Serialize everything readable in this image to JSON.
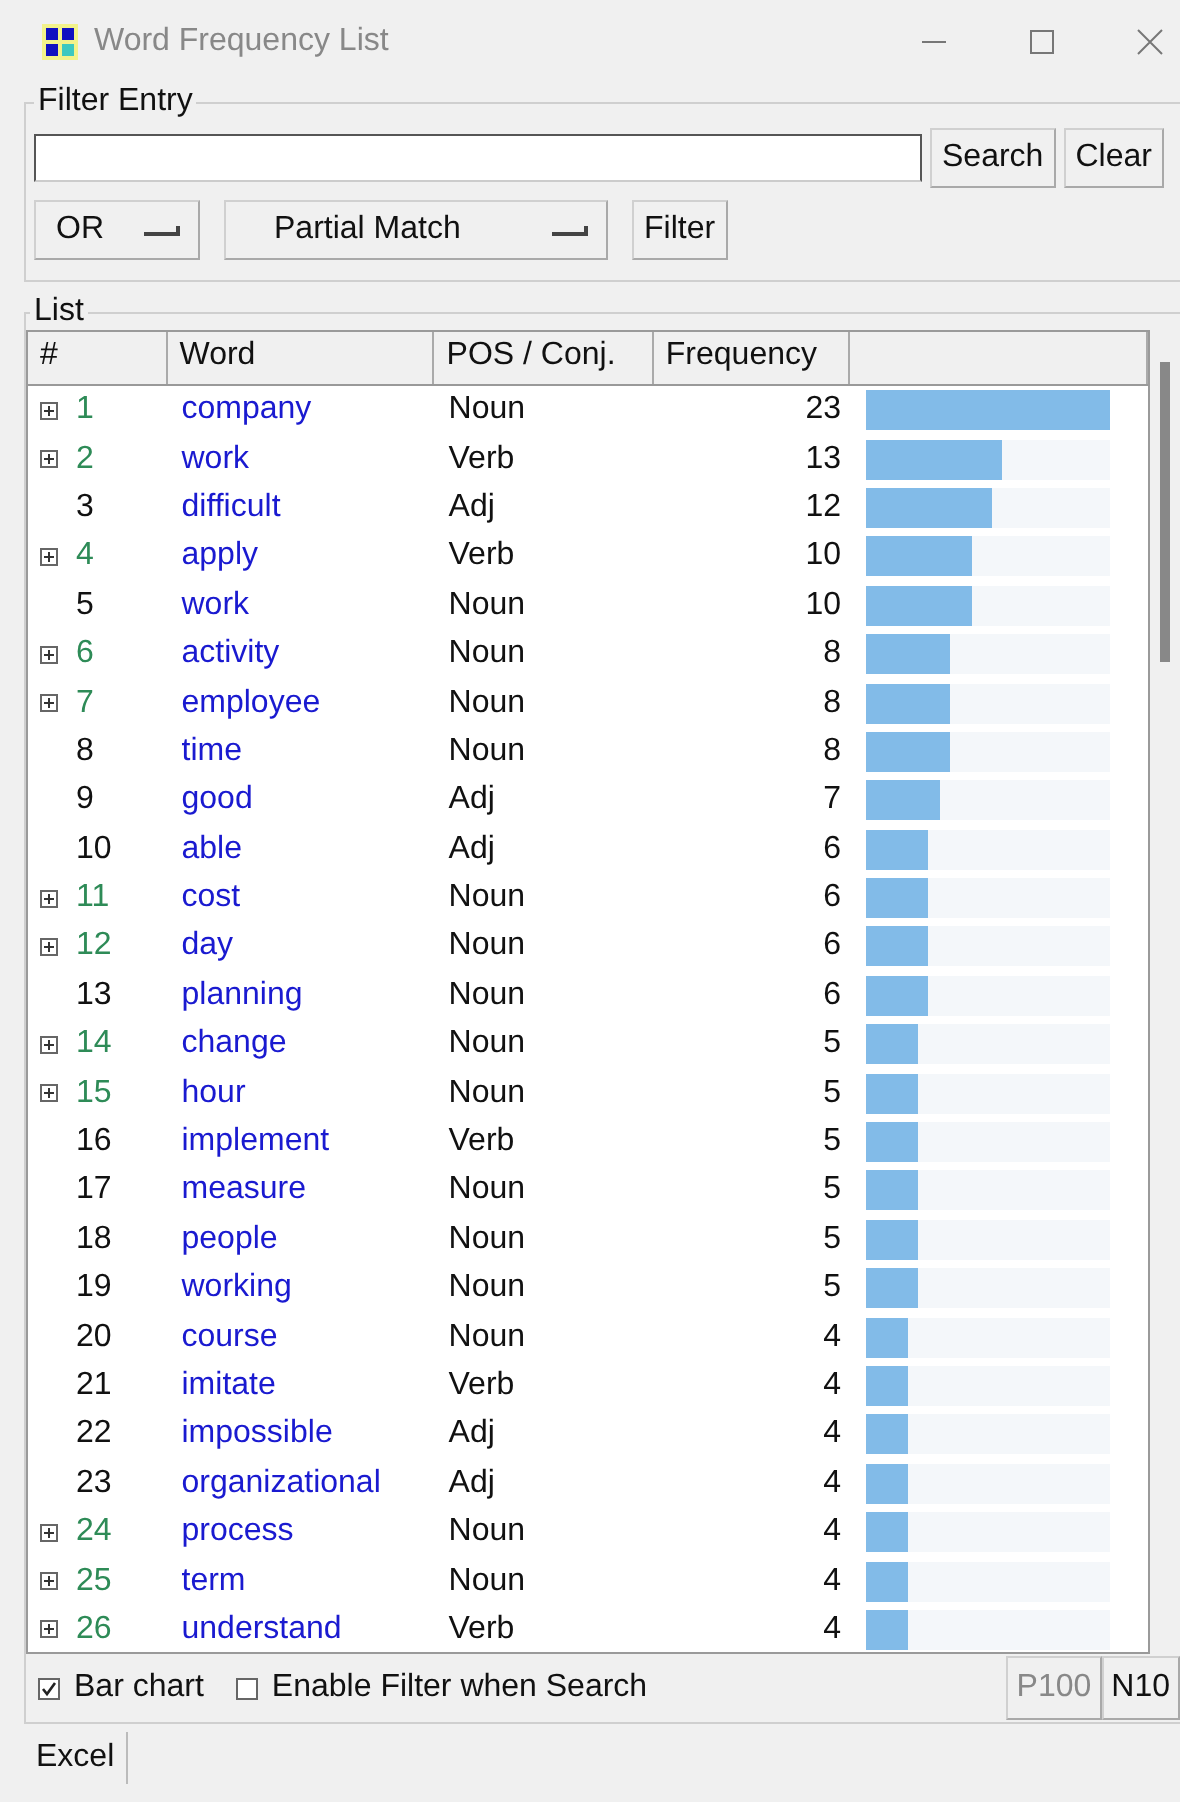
{
  "window": {
    "title": "Word Frequency List"
  },
  "filter_entry": {
    "title": "Filter Entry",
    "search_button": "Search",
    "clear_button": "Clear",
    "logic_menu": "OR",
    "match_menu": "Partial Match",
    "filter_button": "Filter"
  },
  "list": {
    "title": "List",
    "columns": [
      "#",
      "Word",
      "POS / Conj.",
      "Frequency"
    ],
    "rows": [
      {
        "rank": "1",
        "word": "company",
        "pos": "Noun",
        "frequency": "23",
        "expandable": true,
        "level": 1
      },
      {
        "rank": "2",
        "word": "work",
        "pos": "Verb",
        "frequency": "13",
        "expandable": true,
        "level": 0.565
      },
      {
        "rank": "3",
        "word": "difficult",
        "pos": "Adj",
        "frequency": "12",
        "expandable": false,
        "level": 0.522
      },
      {
        "rank": "4",
        "word": "apply",
        "pos": "Verb",
        "frequency": "10",
        "expandable": true,
        "level": 0.435
      },
      {
        "rank": "5",
        "word": "work",
        "pos": "Noun",
        "frequency": "10",
        "expandable": false,
        "level": 0.435
      },
      {
        "rank": "6",
        "word": "activity",
        "pos": "Noun",
        "frequency": "8",
        "expandable": true,
        "level": 0.348
      },
      {
        "rank": "7",
        "word": "employee",
        "pos": "Noun",
        "frequency": "8",
        "expandable": true,
        "level": 0.348
      },
      {
        "rank": "8",
        "word": "time",
        "pos": "Noun",
        "frequency": "8",
        "expandable": false,
        "level": 0.348
      },
      {
        "rank": "9",
        "word": "good",
        "pos": "Adj",
        "frequency": "7",
        "expandable": false,
        "level": 0.304
      },
      {
        "rank": "10",
        "word": "able",
        "pos": "Adj",
        "frequency": "6",
        "expandable": false,
        "level": 0.261
      },
      {
        "rank": "11",
        "word": "cost",
        "pos": "Noun",
        "frequency": "6",
        "expandable": true,
        "level": 0.261
      },
      {
        "rank": "12",
        "word": "day",
        "pos": "Noun",
        "frequency": "6",
        "expandable": true,
        "level": 0.261
      },
      {
        "rank": "13",
        "word": "planning",
        "pos": "Noun",
        "frequency": "6",
        "expandable": false,
        "level": 0.261
      },
      {
        "rank": "14",
        "word": "change",
        "pos": "Noun",
        "frequency": "5",
        "expandable": true,
        "level": 0.217
      },
      {
        "rank": "15",
        "word": "hour",
        "pos": "Noun",
        "frequency": "5",
        "expandable": true,
        "level": 0.217
      },
      {
        "rank": "16",
        "word": "implement",
        "pos": "Verb",
        "frequency": "5",
        "expandable": false,
        "level": 0.217
      },
      {
        "rank": "17",
        "word": "measure",
        "pos": "Noun",
        "frequency": "5",
        "expandable": false,
        "level": 0.217
      },
      {
        "rank": "18",
        "word": "people",
        "pos": "Noun",
        "frequency": "5",
        "expandable": false,
        "level": 0.217
      },
      {
        "rank": "19",
        "word": "working",
        "pos": "Noun",
        "frequency": "5",
        "expandable": false,
        "level": 0.217
      },
      {
        "rank": "20",
        "word": "course",
        "pos": "Noun",
        "frequency": "4",
        "expandable": false,
        "level": 0.174
      },
      {
        "rank": "21",
        "word": "imitate",
        "pos": "Verb",
        "frequency": "4",
        "expandable": false,
        "level": 0.174
      },
      {
        "rank": "22",
        "word": "impossible",
        "pos": "Adj",
        "frequency": "4",
        "expandable": false,
        "level": 0.174
      },
      {
        "rank": "23",
        "word": "organizational",
        "pos": "Adj",
        "frequency": "4",
        "expandable": false,
        "level": 0.174
      },
      {
        "rank": "24",
        "word": "process",
        "pos": "Noun",
        "frequency": "4",
        "expandable": true,
        "level": 0.174
      },
      {
        "rank": "25",
        "word": "term",
        "pos": "Noun",
        "frequency": "4",
        "expandable": true,
        "level": 0.174
      },
      {
        "rank": "26",
        "word": "understand",
        "pos": "Verb",
        "frequency": "4",
        "expandable": true,
        "level": 0.174
      }
    ],
    "options": [
      {
        "label": "Bar chart",
        "checked": true
      },
      {
        "label": "Enable Filter when Search",
        "checked": false
      }
    ],
    "prev_button": "P100",
    "prev_disabled": true,
    "next_button": "N10"
  },
  "excel_button": "Excel"
}
